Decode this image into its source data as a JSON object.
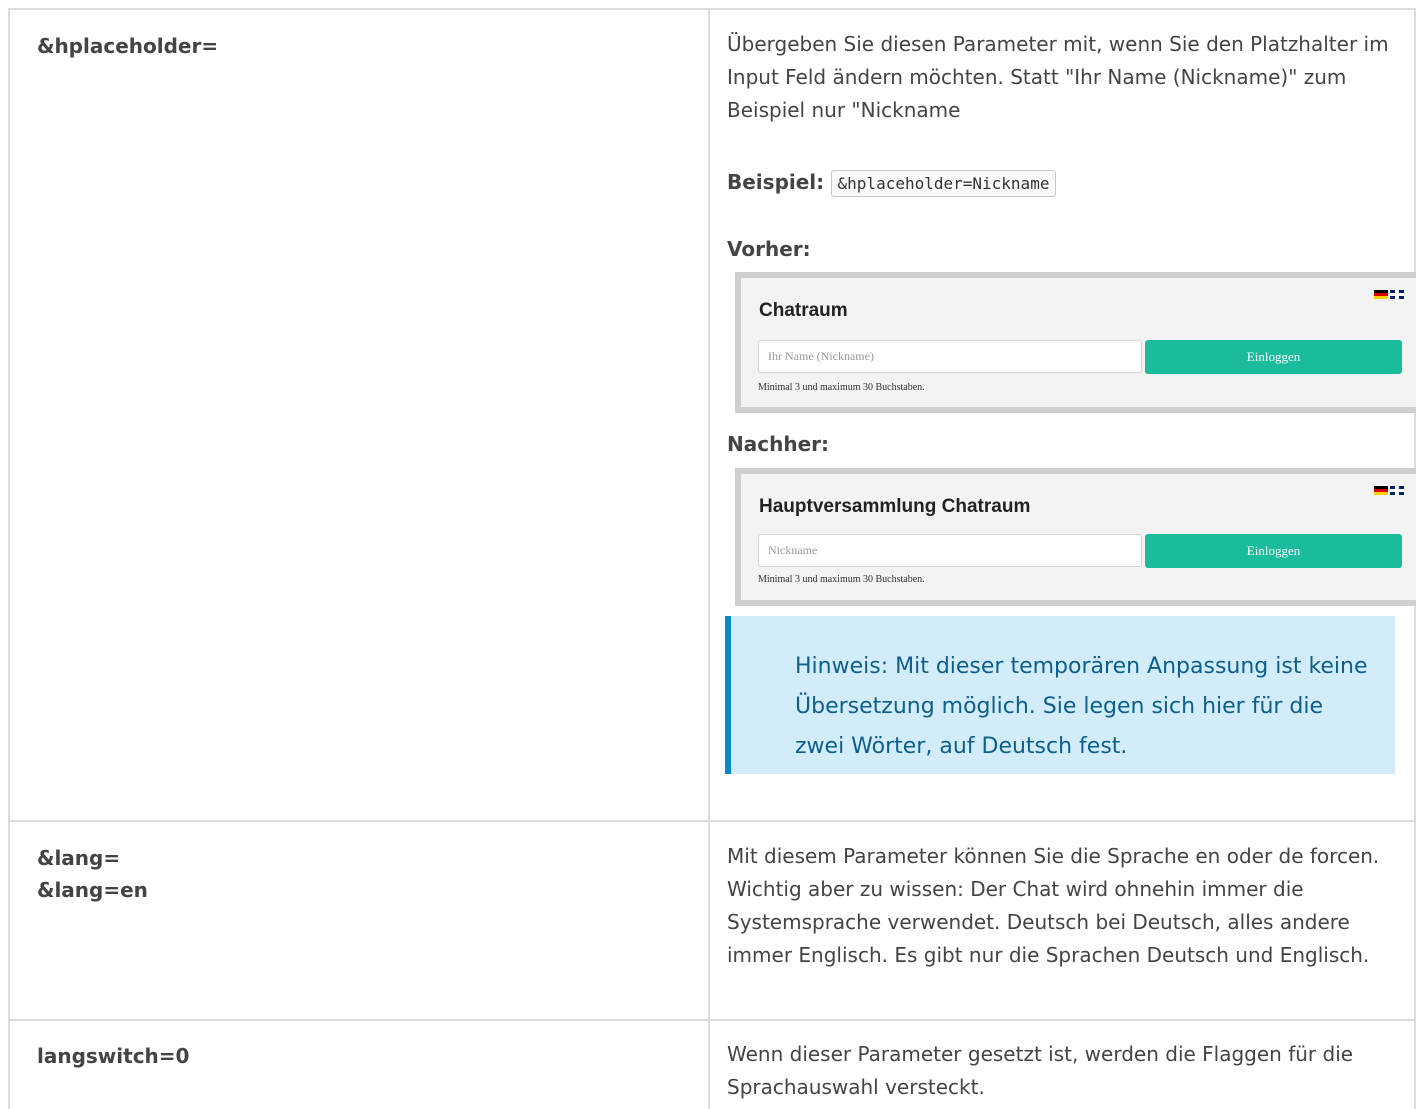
{
  "rows": [
    {
      "param": "&hplaceholder=",
      "description": "Übergeben Sie diesen Parameter mit, wenn Sie den Platzhalter im Input Feld ändern möchten. Statt \"Ihr Name (Nickname)\" zum Beispiel nur \"Nickname",
      "example_label": "Beispiel:",
      "example_code": "&hplaceholder=Nickname",
      "before_label": "Vorher:",
      "after_label": "Nachher:",
      "note": "Hinweis: Mit dieser temporären Anpassung ist keine Übersetzung möglich. Sie legen sich hier für die zwei Wörter, auf Deutsch fest."
    },
    {
      "param_line1": "&lang=",
      "param_line2": "&lang=en",
      "description": "Mit diesem Parameter können Sie die Sprache en oder de forcen. Wichtig aber zu wissen: Der Chat wird ohnehin immer die Systemsprache verwendet. Deutsch bei Deutsch, alles andere immer Englisch. Es gibt nur die Sprachen Deutsch und Englisch."
    },
    {
      "param": "langswitch=0",
      "description": "Wenn dieser Parameter gesetzt ist, werden die Flaggen für die Sprachauswahl versteckt."
    }
  ],
  "before_screenshot": {
    "title": "Chatraum",
    "placeholder": "Ihr Name (Nickname)",
    "button": "Einloggen",
    "hint": "Minimal 3 und maximum 30 Buchstaben.",
    "flags": [
      "de-flag-icon",
      "gb-flag-icon"
    ]
  },
  "after_screenshot": {
    "title": "Hauptversammlung Chatraum",
    "placeholder": "Nickname",
    "button": "Einloggen",
    "hint": "Minimal 3 und maximum 30 Buchstaben.",
    "flags": [
      "de-flag-icon",
      "gb-flag-icon"
    ]
  },
  "colors": {
    "note_background": "#d3ecfa",
    "note_border": "#0288d1",
    "login_button": "#1abc9c"
  }
}
